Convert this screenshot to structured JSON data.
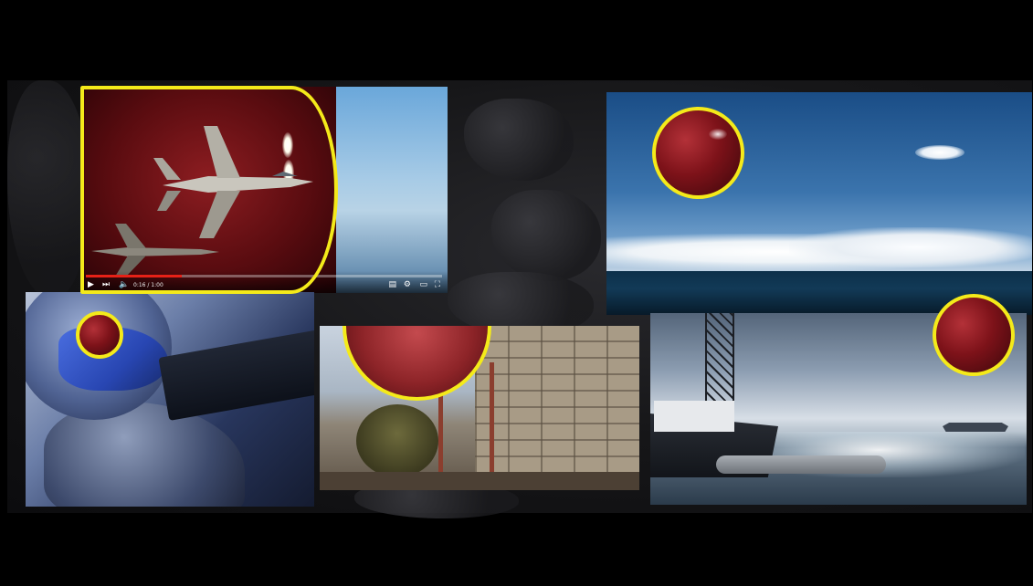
{
  "video": {
    "time_display": "0:16 / 1:00",
    "progress": 0.27,
    "controls": {
      "play_icon": "play-icon",
      "next_icon": "skip-next-icon",
      "volume_icon": "volume-icon",
      "subtitles_icon": "subtitles-icon",
      "settings_icon": "gear-icon",
      "theater_icon": "theater-mode-icon",
      "fullscreen_icon": "fullscreen-icon"
    }
  },
  "highlight": {
    "color": "#f4ea1a",
    "fill_color": "#7d1219"
  },
  "colors": {
    "background": "#000000",
    "progress_bar": "#e62117"
  }
}
